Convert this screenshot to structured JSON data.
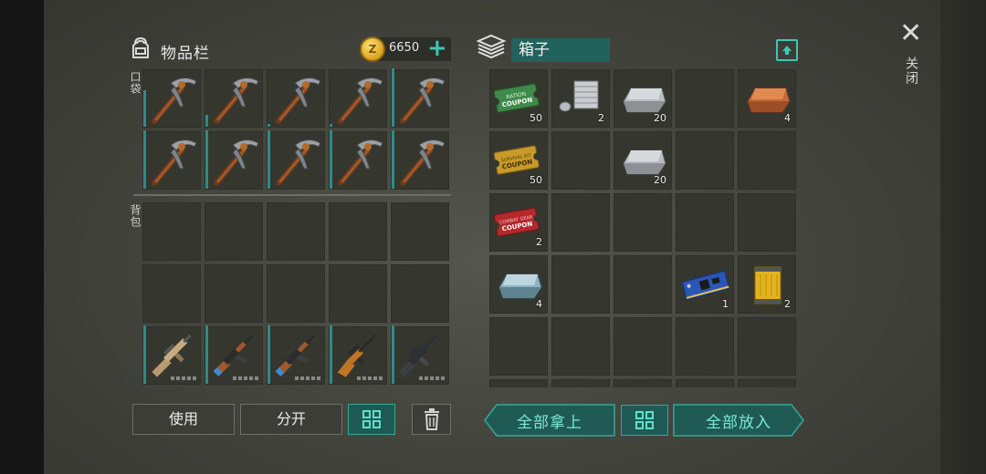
{
  "inventory": {
    "title": "物品栏",
    "coins": "6650",
    "pockets_label": "口袋",
    "backpack_label": "背包",
    "pockets": [
      {
        "item": "pickaxe-icon",
        "durability": 0.62
      },
      {
        "item": "pickaxe-icon",
        "durability": 0.2
      },
      {
        "item": "pickaxe-icon",
        "durability": 0.05
      },
      {
        "item": "pickaxe-icon",
        "durability": 0.05
      },
      {
        "item": "pickaxe-icon",
        "durability": 1.0
      },
      {
        "item": "pickaxe-icon",
        "durability": 1.0
      },
      {
        "item": "pickaxe-icon",
        "durability": 1.0
      },
      {
        "item": "pickaxe-icon",
        "durability": 1.0
      },
      {
        "item": "pickaxe-icon",
        "durability": 1.0
      },
      {
        "item": "pickaxe-icon",
        "durability": 1.0
      }
    ],
    "weapons": [
      {
        "item": "rifle-tan-icon",
        "durability": 1.0
      },
      {
        "item": "ak-rifle-icon",
        "durability": 1.0
      },
      {
        "item": "ak-rifle-icon",
        "durability": 1.0
      },
      {
        "item": "hunting-rifle-icon",
        "durability": 1.0
      },
      {
        "item": "assault-rifle-dark-icon",
        "durability": 1.0
      }
    ],
    "buttons": {
      "use": "使用",
      "split": "分开"
    }
  },
  "box": {
    "title": "箱子",
    "slots": [
      {
        "item": "coupon-green-icon",
        "qty": "50"
      },
      {
        "item": "engine-cylinder-icon",
        "qty": "2"
      },
      {
        "item": "iron-ingot-icon",
        "qty": "20"
      },
      {
        "item": "",
        "qty": ""
      },
      {
        "item": "copper-ingot-icon",
        "qty": "4"
      },
      {
        "item": "coupon-yellow-icon",
        "qty": "50"
      },
      {
        "item": "",
        "qty": ""
      },
      {
        "item": "iron-ingot-icon",
        "qty": "20"
      },
      {
        "item": "",
        "qty": ""
      },
      {
        "item": "",
        "qty": ""
      },
      {
        "item": "coupon-red-icon",
        "qty": "2"
      },
      {
        "item": "",
        "qty": ""
      },
      {
        "item": "",
        "qty": ""
      },
      {
        "item": "",
        "qty": ""
      },
      {
        "item": "",
        "qty": ""
      },
      {
        "item": "steel-ingot-icon",
        "qty": "4"
      },
      {
        "item": "",
        "qty": ""
      },
      {
        "item": "",
        "qty": ""
      },
      {
        "item": "circuit-board-icon",
        "qty": "1"
      },
      {
        "item": "oil-filter-icon",
        "qty": "2"
      }
    ],
    "buttons": {
      "take_all": "全部拿上",
      "put_all": "全部放入"
    }
  },
  "close_label": "关闭",
  "colors": {
    "accent": "#3ec7b4",
    "teal_dark": "#21635c",
    "cell": "#35372f"
  }
}
